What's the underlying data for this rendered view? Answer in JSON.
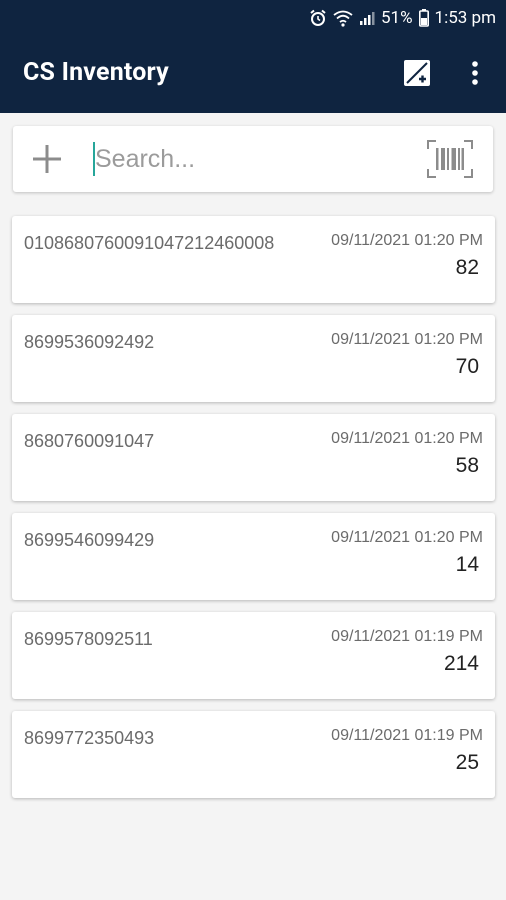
{
  "status": {
    "battery": "51%",
    "time": "1:53 pm"
  },
  "app": {
    "title": "CS Inventory"
  },
  "search": {
    "placeholder": "Search..."
  },
  "items": [
    {
      "code": "0108680760091047212460008",
      "date": "09/11/2021 01:20 PM",
      "qty": "82"
    },
    {
      "code": "8699536092492",
      "date": "09/11/2021 01:20 PM",
      "qty": "70"
    },
    {
      "code": "8680760091047",
      "date": "09/11/2021 01:20 PM",
      "qty": "58"
    },
    {
      "code": "8699546099429",
      "date": "09/11/2021 01:20 PM",
      "qty": "14"
    },
    {
      "code": "8699578092511",
      "date": "09/11/2021 01:19 PM",
      "qty": "214"
    },
    {
      "code": "8699772350493",
      "date": "09/11/2021 01:19 PM",
      "qty": "25"
    }
  ],
  "colors": {
    "app_bar": "#0f2440",
    "background": "#f4f4f4",
    "cursor": "#26a69a"
  },
  "icons": [
    "alarm-icon",
    "wifi-icon",
    "signal-icon",
    "battery-icon",
    "sort-icon",
    "more-vert-icon",
    "add-icon",
    "barcode-scan-icon"
  ]
}
